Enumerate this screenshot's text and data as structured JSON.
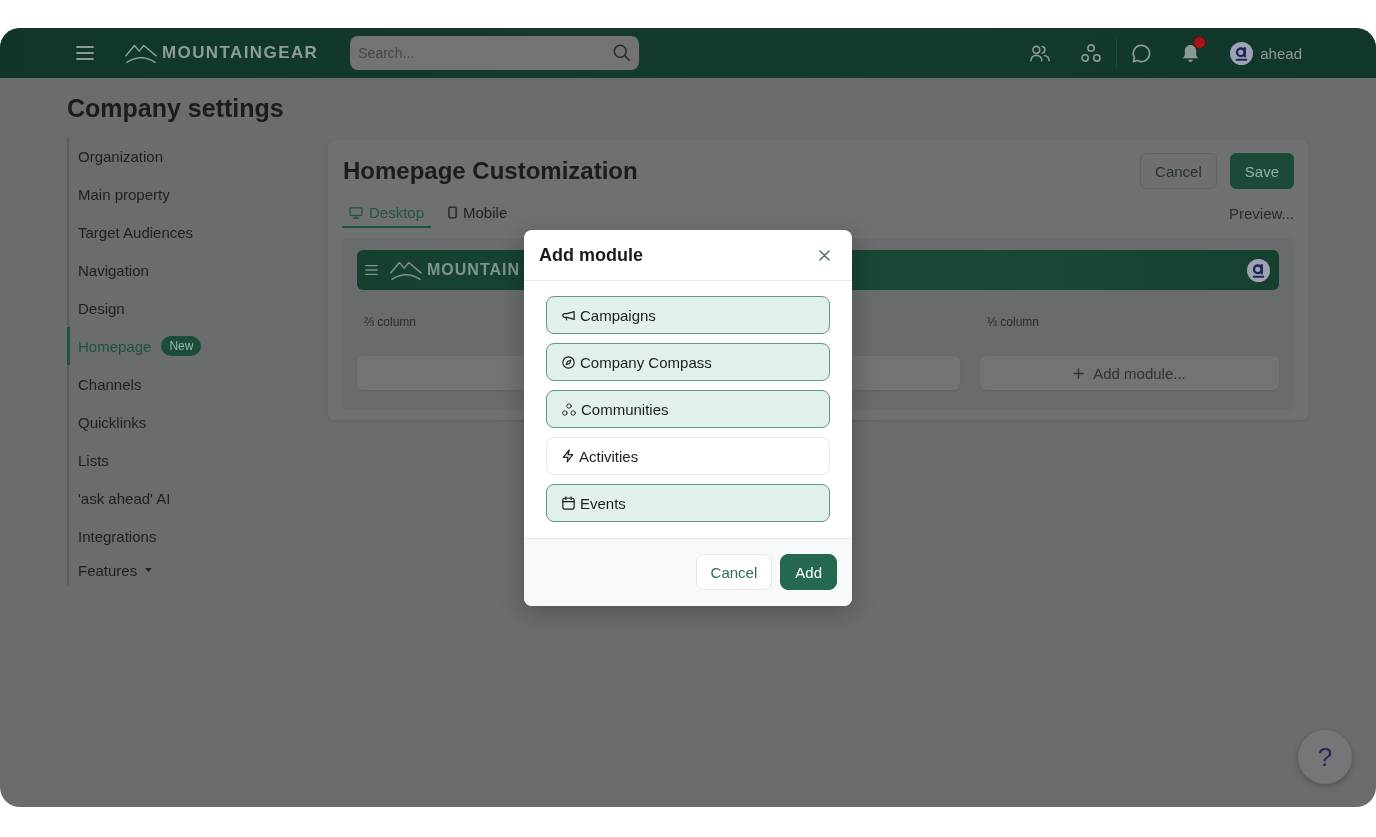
{
  "topbar": {
    "brand": "MOUNTAINGEAR",
    "search": {
      "placeholder": "Search..."
    },
    "unread_notifications": true,
    "user": {
      "name": "ahead"
    }
  },
  "page": {
    "title": "Company settings"
  },
  "sidebar": {
    "items": [
      {
        "label": "Organization",
        "kind": "link",
        "selected": false
      },
      {
        "label": "Main property",
        "kind": "link",
        "selected": false
      },
      {
        "label": "Target Audiences",
        "kind": "link",
        "selected": false
      },
      {
        "label": "Navigation",
        "kind": "link",
        "selected": false
      },
      {
        "label": "Design",
        "kind": "link",
        "selected": false
      },
      {
        "label": "Homepage",
        "kind": "link",
        "selected": true,
        "badge": "New"
      },
      {
        "label": "Channels",
        "kind": "link",
        "selected": false
      },
      {
        "label": "Quicklinks",
        "kind": "link",
        "selected": false
      },
      {
        "label": "Lists",
        "kind": "link",
        "selected": false
      },
      {
        "label": "'ask ahead' AI",
        "kind": "link",
        "selected": false
      },
      {
        "label": "Integrations",
        "kind": "link",
        "selected": false
      },
      {
        "label": "Features",
        "kind": "dropdown",
        "selected": false
      }
    ]
  },
  "editor": {
    "title": "Homepage Customization",
    "actions": [
      {
        "label": "Cancel",
        "kind": "secondary"
      },
      {
        "label": "Save",
        "kind": "primary"
      }
    ],
    "tabs": [
      {
        "label": "Desktop",
        "selected": true
      },
      {
        "label": "Mobile",
        "selected": false
      }
    ],
    "preview_link": "Preview...",
    "preview_header": {
      "brand": "MOUNTAIN"
    },
    "columns": [
      {
        "label": "⅔ column"
      },
      {
        "label": "⅓ column",
        "add_button": "Add module..."
      }
    ]
  },
  "modal": {
    "title": "Add module",
    "modules": [
      {
        "label": "Campaigns",
        "selected": true
      },
      {
        "label": "Company Compass",
        "selected": true
      },
      {
        "label": "Communities",
        "selected": true
      },
      {
        "label": "Activities",
        "selected": false
      },
      {
        "label": "Events",
        "selected": true
      }
    ],
    "buttons": [
      {
        "label": "Cancel",
        "kind": "secondary"
      },
      {
        "label": "Add",
        "kind": "primary"
      }
    ]
  },
  "help_button": {
    "label": "?"
  }
}
